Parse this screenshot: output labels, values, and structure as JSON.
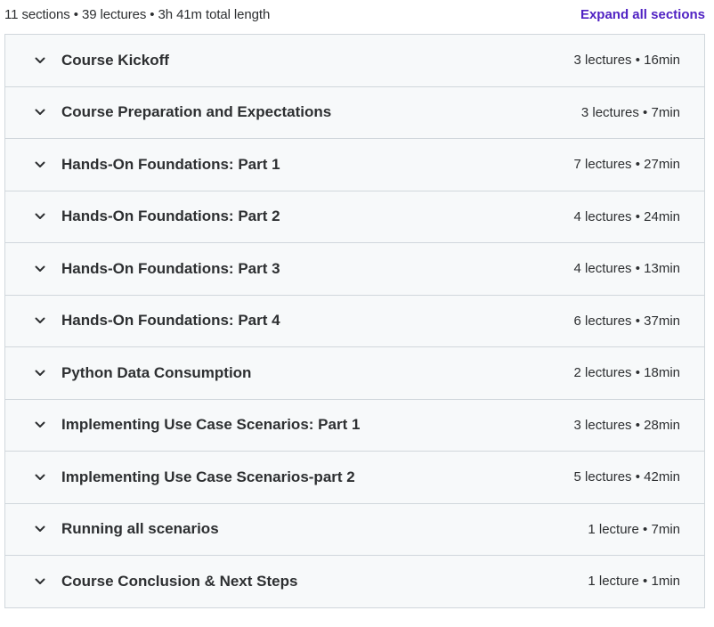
{
  "summary": {
    "text": "11 sections • 39 lectures • 3h 41m total length",
    "expand_label": "Expand all sections",
    "link_color": "#5022c3"
  },
  "sections": [
    {
      "title": "Course Kickoff",
      "meta": "3 lectures • 16min"
    },
    {
      "title": "Course Preparation and Expectations",
      "meta": "3 lectures • 7min"
    },
    {
      "title": "Hands-On Foundations: Part 1",
      "meta": "7 lectures • 27min"
    },
    {
      "title": "Hands-On Foundations: Part 2",
      "meta": "4 lectures • 24min"
    },
    {
      "title": "Hands-On Foundations: Part 3",
      "meta": "4 lectures • 13min"
    },
    {
      "title": "Hands-On Foundations: Part 4",
      "meta": "6 lectures • 37min"
    },
    {
      "title": "Python Data Consumption",
      "meta": "2 lectures • 18min"
    },
    {
      "title": "Implementing Use Case Scenarios: Part 1",
      "meta": "3 lectures • 28min"
    },
    {
      "title": "Implementing Use Case Scenarios-part 2",
      "meta": "5 lectures • 42min"
    },
    {
      "title": "Running all scenarios",
      "meta": "1 lecture • 7min"
    },
    {
      "title": "Course Conclusion & Next Steps",
      "meta": "1 lecture • 1min"
    }
  ],
  "icons": {
    "section_toggle": "chevron-down-icon"
  }
}
